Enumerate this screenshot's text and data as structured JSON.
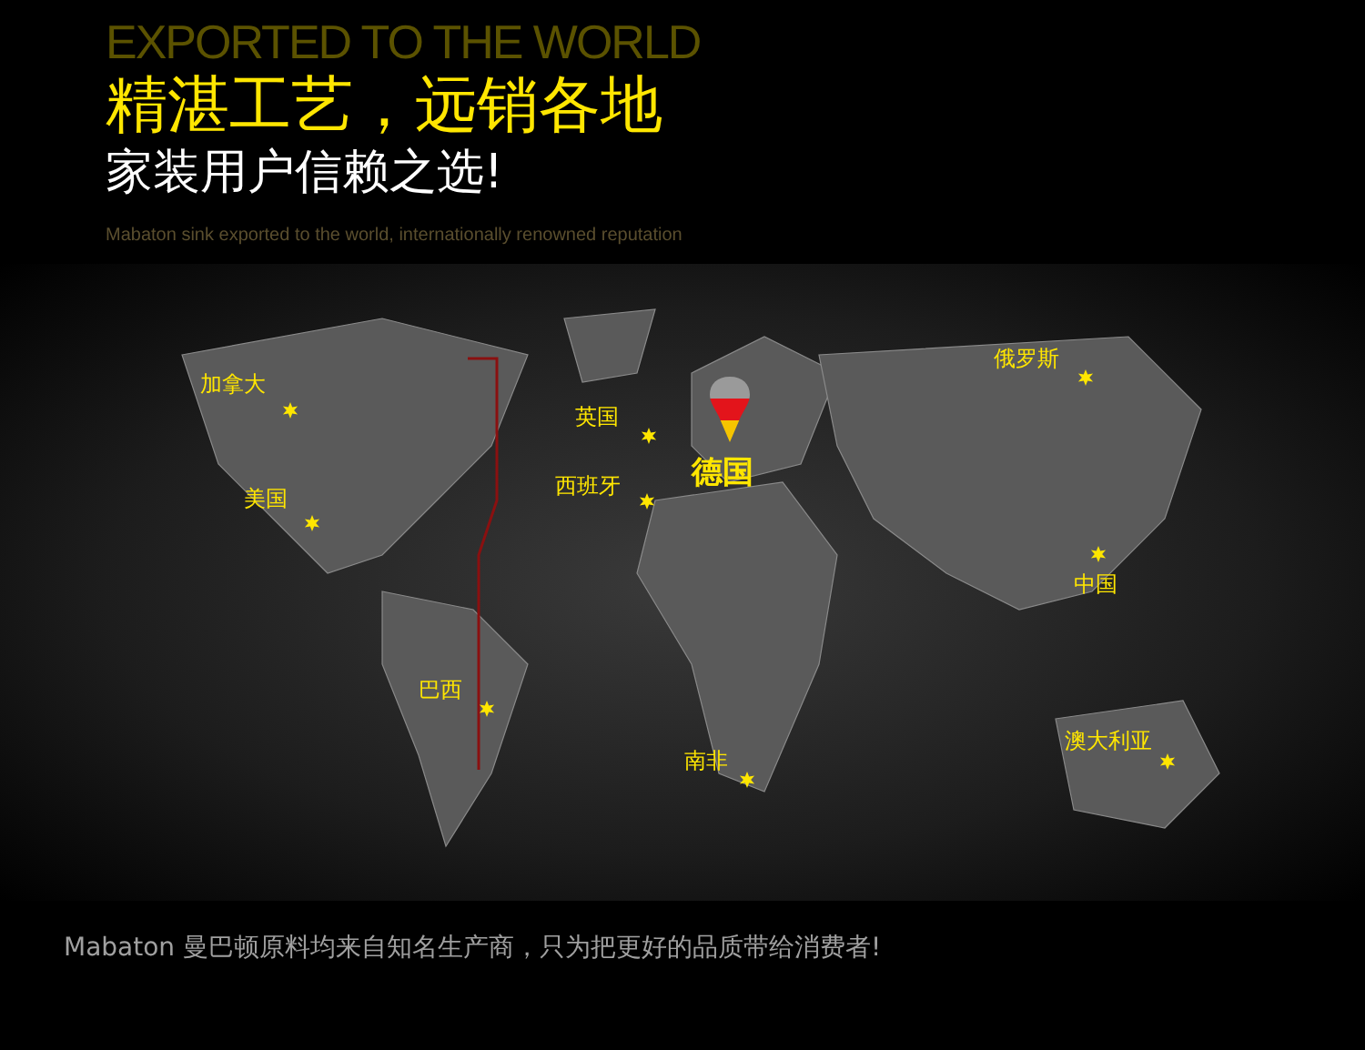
{
  "header": {
    "eyebrow": "EXPORTED TO THE WORLD",
    "headline": "精湛工艺，远销各地",
    "subheadline": "家装用户信赖之选!",
    "tagline": "Mabaton sink exported to the world, internationally renowned reputation"
  },
  "map": {
    "markers": [
      {
        "kind": "star",
        "label": "加拿大"
      },
      {
        "kind": "star",
        "label": "美国"
      },
      {
        "kind": "star",
        "label": "英国"
      },
      {
        "kind": "star",
        "label": "西班牙"
      },
      {
        "kind": "pin",
        "label": "德国"
      },
      {
        "kind": "star",
        "label": "俄罗斯"
      },
      {
        "kind": "star",
        "label": "中国"
      },
      {
        "kind": "star",
        "label": "巴西"
      },
      {
        "kind": "star",
        "label": "南非"
      },
      {
        "kind": "star",
        "label": "澳大利亚"
      }
    ]
  },
  "footer": {
    "text": "Mabaton 曼巴顿原料均来自知名生产商，只为把更好的品质带给消费者!"
  }
}
